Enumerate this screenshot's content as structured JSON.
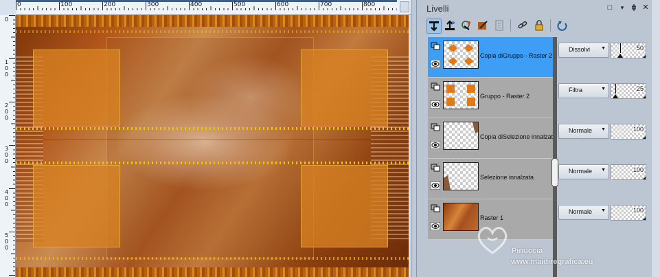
{
  "canvas": {
    "top_ruler_labels": [
      "0",
      "100",
      "200",
      "300",
      "400",
      "500",
      "600",
      "700",
      "800"
    ],
    "left_ruler_labels": [
      [
        "0"
      ],
      [
        "1",
        "0",
        "0"
      ],
      [
        "2",
        "0",
        "0"
      ],
      [
        "3",
        "0",
        "0"
      ],
      [
        "4",
        "0",
        "0"
      ],
      [
        "5",
        "0",
        "0"
      ]
    ]
  },
  "layers_palette": {
    "title": "Livelli",
    "window_controls": [
      "□",
      "▾",
      "✕"
    ],
    "toolbar": [
      "new-raster-layer-icon",
      "new-vector-layer-icon",
      "new-adjustment-layer-icon",
      "new-mask-layer-icon",
      "new-group-icon",
      "link-icon",
      "lock-icon",
      "refresh-icon"
    ],
    "layers": [
      {
        "name": "Copia diGruppo - Raster 2",
        "blend": "Dissolvi",
        "opacity": "50",
        "opacity_fraction": 0.5,
        "selected": true
      },
      {
        "name": "Gruppo - Raster 2",
        "blend": "Filtra",
        "opacity": "25",
        "opacity_fraction": 0.25,
        "selected": false
      },
      {
        "name": "Copia diSelezione innalzata",
        "blend": "Normale",
        "opacity": "100",
        "opacity_fraction": 1.0,
        "selected": false
      },
      {
        "name": "Selezione innalzata",
        "blend": "Normale",
        "opacity": "100",
        "opacity_fraction": 1.0,
        "selected": false
      },
      {
        "name": "Raster 1",
        "blend": "Normale",
        "opacity": "100",
        "opacity_fraction": 1.0,
        "selected": false
      }
    ]
  },
  "watermark": {
    "line1": "Pinuccia",
    "line2": "www.maidiregrafica.eu"
  },
  "colors": {
    "selection_blue": "#3e9df4",
    "accent_orange": "#d98a1f"
  }
}
